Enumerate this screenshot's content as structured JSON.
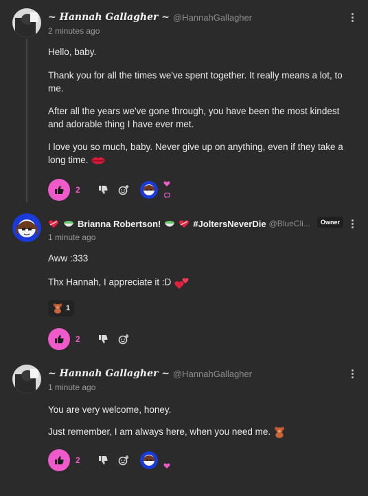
{
  "posts": [
    {
      "author": "~ Hannah Gallagher ~",
      "handle": "@HannahGallagher",
      "time": "2 minutes ago",
      "paragraphs": [
        "Hello, baby.",
        "Thank you for all the times we've spent together. It really means a lot, to me.",
        "After all the years we've gone through, you have been the most kindest and adorable thing I have ever met.",
        "I love you so much, baby. Never give up on anything, even if they take a long time."
      ],
      "like_count": "2"
    },
    {
      "author": "Brianna Robertson!",
      "tag": "#JoltersNeverDie",
      "handle": "@BlueCli...",
      "badge": "Owner",
      "time": "1 minute ago",
      "paragraphs": [
        "Aww :333",
        "Thx Hannah, I appreciate it :D"
      ],
      "reaction_count": "1",
      "like_count": "2"
    },
    {
      "author": "~ Hannah Gallagher ~",
      "handle": "@HannahGallagher",
      "time": "1 minute ago",
      "paragraphs": [
        "You are very welcome, honey.",
        "Just remember, I am always here, when you need me."
      ],
      "like_count": "2"
    }
  ],
  "icons": {
    "like": "thumbs-up-icon",
    "dislike": "thumbs-down-icon",
    "react": "add-reaction-icon",
    "more": "more-vertical-icon"
  },
  "colors": {
    "background": "#2b2b2b",
    "accent": "#f05acb",
    "text": "#ececec",
    "muted": "#9a9a9a"
  }
}
